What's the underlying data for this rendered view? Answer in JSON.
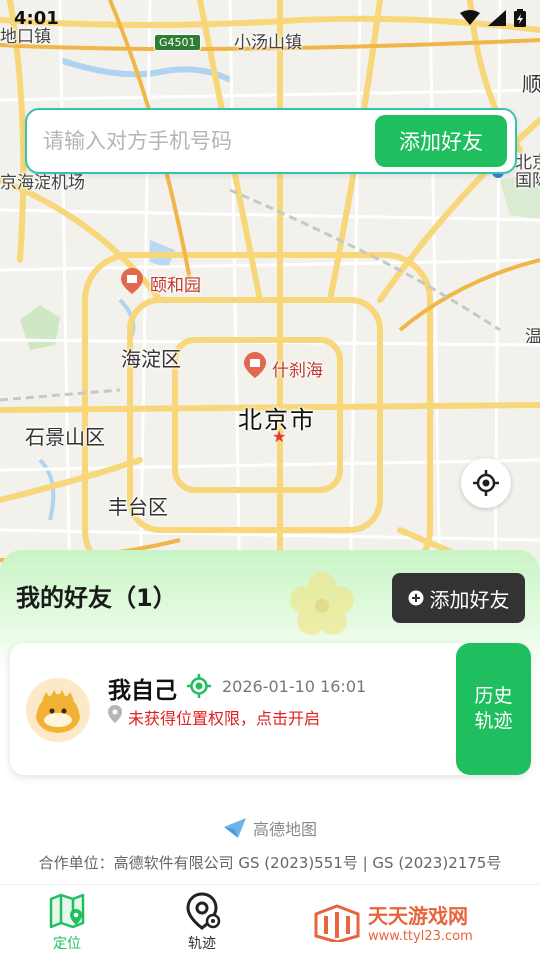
{
  "status_bar": {
    "time": "4:01"
  },
  "map": {
    "labels": {
      "xiaotangshan": "小汤山镇",
      "top_left": "地口镇",
      "haidian_airport": "京海淀机场",
      "yiheyuan": "颐和园",
      "haidian": "海淀区",
      "shichahai": "什刹海",
      "beijing": "北京市",
      "shijingshan": "石景山区",
      "fengtai": "丰台区",
      "right_edge_1": "北京",
      "right_edge_2": "国际",
      "right_edge_3": "顺",
      "right_edge_4": "温",
      "highway": "G4501"
    }
  },
  "search": {
    "placeholder": "请输入对方手机号码",
    "button": "添加好友"
  },
  "panel": {
    "title": "我的好友（1）",
    "add_button": "添加好友"
  },
  "friend": {
    "name": "我自己",
    "time": "2026-01-10 16:01",
    "permission_text": "未获得位置权限，点击开启",
    "history_line1": "历史",
    "history_line2": "轨迹"
  },
  "footer": {
    "amap_name": "高德地图",
    "partner": "合作单位：高德软件有限公司 GS (2023)551号 | GS (2023)2175号"
  },
  "tabs": [
    {
      "label": "定位",
      "icon": "map-pin-icon",
      "active": true
    },
    {
      "label": "轨迹",
      "icon": "track-pin-icon",
      "active": false
    }
  ],
  "watermark": {
    "title": "天天游戏网",
    "url": "www.ttyl23.com"
  },
  "colors": {
    "accent": "#1fbf5f",
    "search_border": "#33c4b0",
    "error": "#e02020",
    "dark_button": "#333333"
  }
}
